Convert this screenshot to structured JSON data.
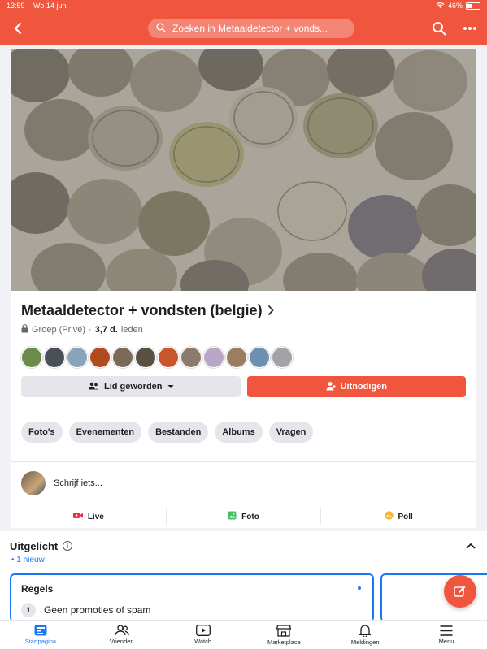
{
  "status": {
    "time": "13:59",
    "date": "Wo 14 jun.",
    "battery": "46%"
  },
  "header": {
    "search_placeholder": "Zoeken in Metaaldetector + vonds..."
  },
  "group": {
    "name": "Metaaldetector + vondsten (belgie)",
    "privacy": "Groep (Privé)",
    "separator": "·",
    "members_count": "3,7 d.",
    "members_label": "leden"
  },
  "buttons": {
    "join": "Lid geworden",
    "invite": "Uitnodigen"
  },
  "chips": [
    "Foto's",
    "Evenementen",
    "Bestanden",
    "Albums",
    "Vragen"
  ],
  "composer": {
    "prompt": "Schrijf iets..."
  },
  "post_types": [
    {
      "label": "Live",
      "color": "#f02849"
    },
    {
      "label": "Foto",
      "color": "#45bd62"
    },
    {
      "label": "Poll",
      "color": "#f7b928"
    }
  ],
  "featured": {
    "title": "Uitgelicht",
    "new_count": "• 1 nieuw",
    "rules_title": "Regels",
    "rules": [
      {
        "num": "1",
        "text": "Geen promoties of spam"
      }
    ]
  },
  "tabs": [
    {
      "label": "Startpagina",
      "active": true
    },
    {
      "label": "Vrienden",
      "active": false
    },
    {
      "label": "Watch",
      "active": false
    },
    {
      "label": "Marketplace",
      "active": false
    },
    {
      "label": "Meldingen",
      "active": false
    },
    {
      "label": "Menu",
      "active": false
    }
  ],
  "colors": {
    "accent": "#f0553e",
    "blue": "#1877f2"
  }
}
